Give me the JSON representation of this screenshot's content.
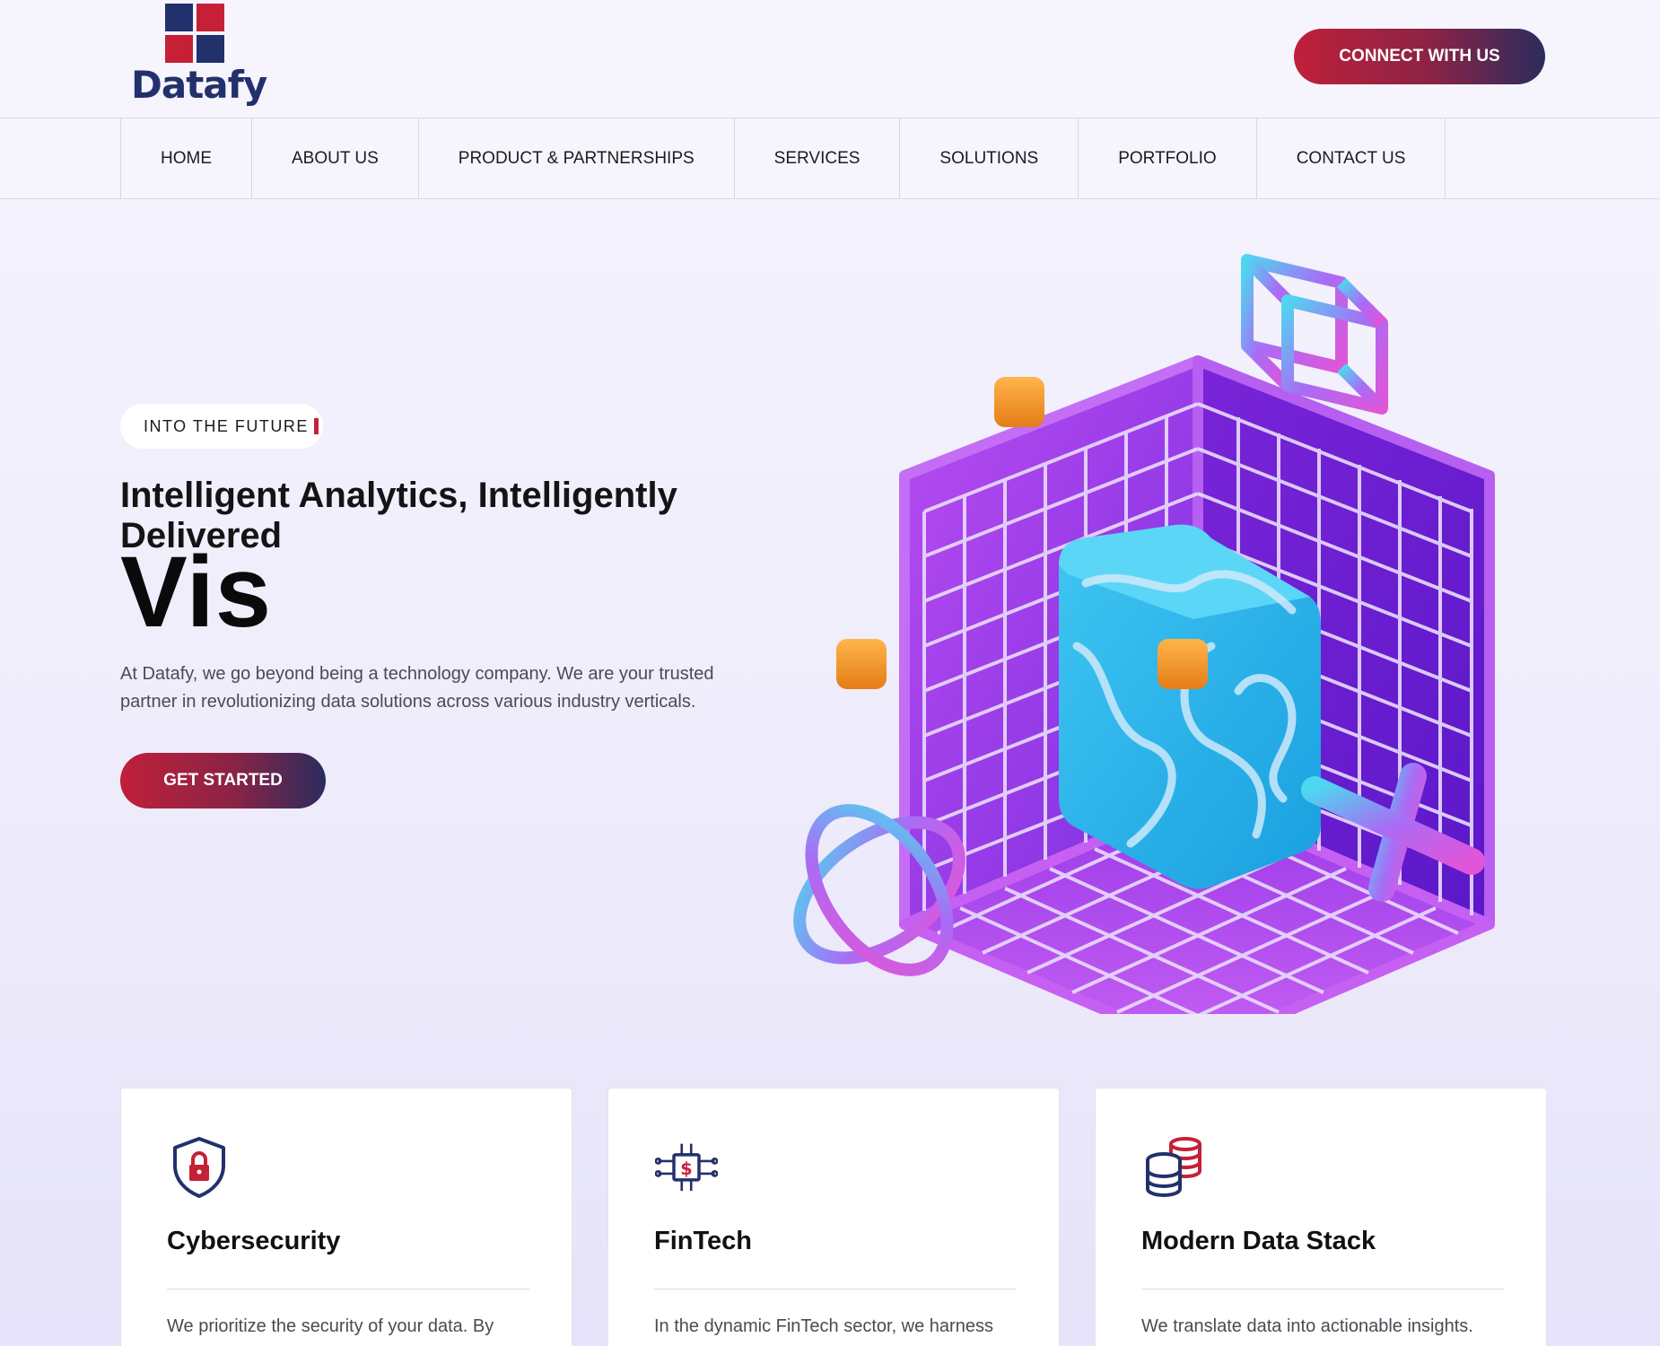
{
  "brand": {
    "name": "Datafy",
    "colors": {
      "navy": "#22316c",
      "red": "#c62036"
    }
  },
  "header": {
    "connect_label": "CONNECT WITH US"
  },
  "nav": {
    "items": [
      {
        "label": "HOME"
      },
      {
        "label": "ABOUT US"
      },
      {
        "label": "PRODUCT & PARTNERSHIPS"
      },
      {
        "label": "SERVICES"
      },
      {
        "label": "SOLUTIONS"
      },
      {
        "label": "PORTFOLIO"
      },
      {
        "label": "CONTACT US"
      }
    ]
  },
  "hero": {
    "tag": "INTO THE FUTURE",
    "subtitle": "Intelligent Analytics, Intelligently Delivered",
    "typed_word": "Vis",
    "description": "At Datafy, we go beyond being a technology company. We are your trusted partner in revolutionizing data solutions across various industry verticals.",
    "cta_label": "GET STARTED",
    "illustration": "3d-grid-cube-illustration"
  },
  "cards": [
    {
      "icon": "shield-lock-icon",
      "title": "Cybersecurity",
      "text": "We prioritize the security of your data. By"
    },
    {
      "icon": "fintech-chip-icon",
      "title": "FinTech",
      "text": "In the dynamic FinTech sector, we harness"
    },
    {
      "icon": "database-stack-icon",
      "title": "Modern Data Stack",
      "text": "We translate data into actionable insights."
    }
  ]
}
